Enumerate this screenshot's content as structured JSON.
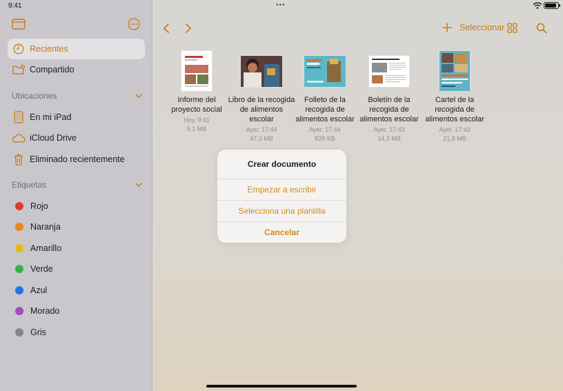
{
  "status": {
    "time": "9:41"
  },
  "sidebar": {
    "items": [
      {
        "label": "Recientes",
        "icon": "clock-icon"
      },
      {
        "label": "Compartido",
        "icon": "shared-folder-icon"
      }
    ],
    "locations_header": "Ubicaciones",
    "locations": [
      {
        "label": "En mi iPad",
        "icon": "ipad-icon"
      },
      {
        "label": "iCloud Drive",
        "icon": "cloud-icon"
      },
      {
        "label": "Eliminado recientemente",
        "icon": "trash-icon"
      }
    ],
    "tags_header": "Etiquetas",
    "tags": [
      {
        "label": "Rojo",
        "color": "#e03a2f"
      },
      {
        "label": "Naranja",
        "color": "#e78a1e"
      },
      {
        "label": "Amarillo",
        "color": "#e6b91a"
      },
      {
        "label": "Verde",
        "color": "#34b24a"
      },
      {
        "label": "Azul",
        "color": "#2374e1"
      },
      {
        "label": "Morado",
        "color": "#a04bbf"
      },
      {
        "label": "Gris",
        "color": "#858488"
      }
    ]
  },
  "toolbar": {
    "select_label": "Seleccionar"
  },
  "files": [
    {
      "name_line1": "Informe del",
      "name_line2": "proyecto social",
      "name_line3": "",
      "date": "Hoy, 9:41",
      "size": "9,1 MB"
    },
    {
      "name_line1": "Libro de la recogida",
      "name_line2": "de alimentos escolar",
      "name_line3": "",
      "date": "Ayer, 17:44",
      "size": "47,3 MB"
    },
    {
      "name_line1": "Folleto de la",
      "name_line2": "recogida de",
      "name_line3": "alimentos escolar",
      "date": "Ayer, 17:44",
      "size": "839 KB"
    },
    {
      "name_line1": "Boletín de la",
      "name_line2": "recogida de",
      "name_line3": "alimentos escolar",
      "date": "Ayer, 17:43",
      "size": "14,3 MB"
    },
    {
      "name_line1": "Cartel de la",
      "name_line2": "recogida de",
      "name_line3": "alimentos escolar",
      "date": "Ayer, 17:43",
      "size": "21,9 MB"
    }
  ],
  "dialog": {
    "title": "Crear documento",
    "option1": "Empezar a escribir",
    "option2": "Selecciona una plantilla",
    "cancel": "Cancelar"
  },
  "colors": {
    "accent": "#c47a12"
  }
}
